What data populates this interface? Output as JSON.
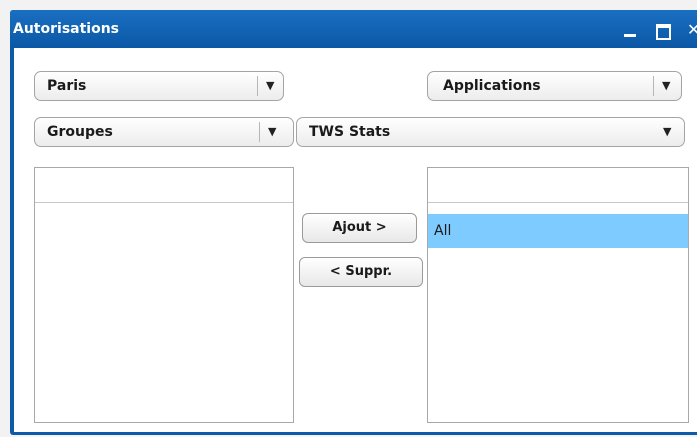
{
  "window": {
    "title": "Autorisations",
    "minimize_label": "_",
    "close_label": "✕"
  },
  "combos": {
    "location": {
      "value": "Paris"
    },
    "type": {
      "value": "Applications"
    },
    "groups": {
      "value": "Groupes"
    },
    "application": {
      "value": "TWS Stats"
    }
  },
  "arrow_glyph": "▼",
  "buttons": {
    "add": "Ajout >",
    "remove": "< Suppr."
  },
  "right_list": {
    "items": [
      "All"
    ],
    "selected_index": 0
  },
  "colors": {
    "title_bar": "#0b58a6",
    "selection": "#7ecbff"
  }
}
